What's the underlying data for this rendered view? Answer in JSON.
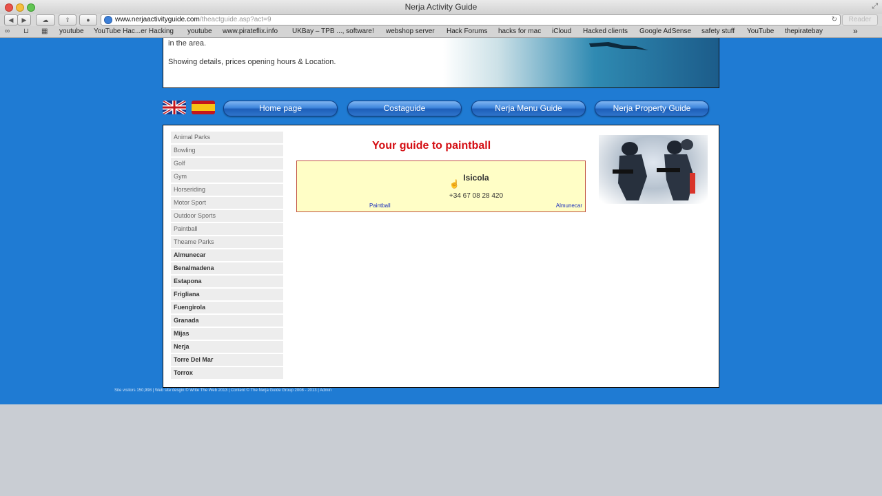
{
  "browser": {
    "window_title": "Nerja Activity Guide",
    "url_main": "www.nerjaactivityguide.com",
    "url_path": "/theactguide.asp?act=9",
    "reader_label": "Reader",
    "bookmarks": [
      "youtube",
      "YouTube Hac...er Hacking",
      "youtube",
      "www.pirateflix.info",
      "UKBay – TPB ..., software!",
      "webshop server",
      "Hack Forums",
      "hacks for mac",
      "iCloud",
      "Hacked clients",
      "Google AdSense",
      "safety stuff",
      "YouTube",
      "thepiratebay"
    ]
  },
  "hero": {
    "text_partial": "in the area.",
    "text_details": "Showing details, prices opening hours & Location."
  },
  "nav": {
    "home": "Home page",
    "costa": "Costaguide",
    "menu": "Nerja Menu Guide",
    "property": "Nerja Property Guide"
  },
  "sidebar": {
    "items": [
      "Animal Parks",
      "Bowling",
      "Golf",
      "Gym",
      "Horseriding",
      "Motor Sport",
      "Outdoor Sports",
      "Paintball",
      "Theame Parks"
    ],
    "towns": [
      "Almunecar",
      "Benalmadena",
      "Estapona",
      "Frigliana",
      "Fuengirola",
      "Granada",
      "Mijas",
      "Nerja",
      "Torre Del Mar",
      "Torrox"
    ]
  },
  "main": {
    "title": "Your guide to paintball",
    "card": {
      "name": "Isicola",
      "phone": "+34 67 08 28 420",
      "category": "Paintball",
      "location": "Almunecar"
    }
  },
  "footer": {
    "text": "Site visitors 150,998 | Web site desgin © Write The Web 2013 | Content © The Nerja Guide Group 2008 - 2013 | Admin"
  },
  "colors": {
    "page_bg": "#1f7bd3",
    "title_red": "#d40d12",
    "card_bg": "#fffec6"
  }
}
